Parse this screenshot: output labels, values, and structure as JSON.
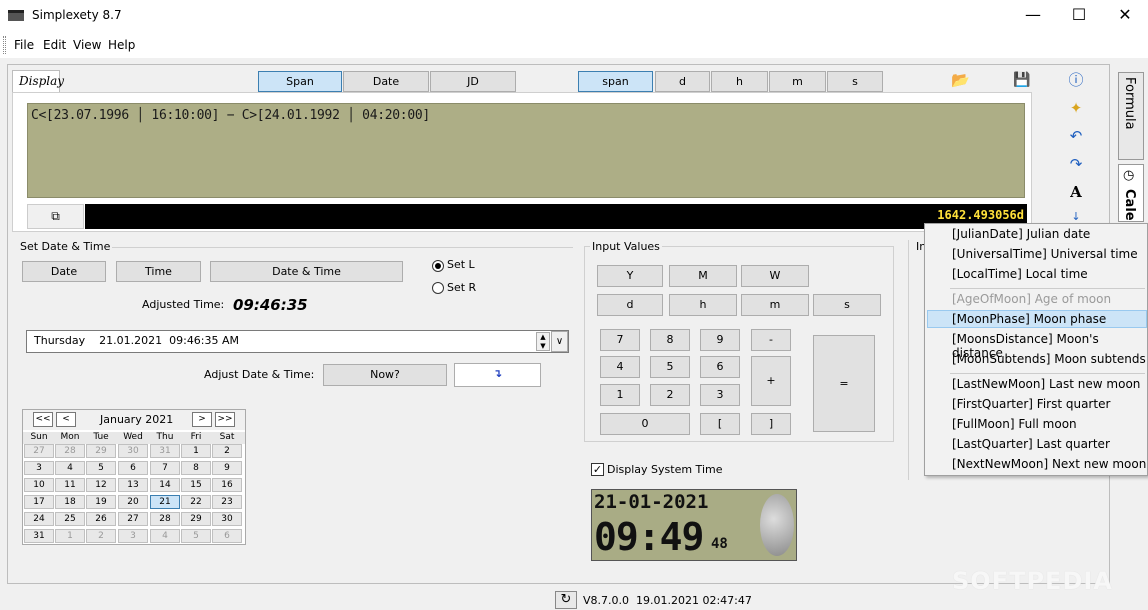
{
  "window": {
    "title": "Simplexety 8.7"
  },
  "menu": [
    "File",
    "Edit",
    "View",
    "Help"
  ],
  "display": {
    "tab_label": "Display",
    "mode_buttons": [
      "Span",
      "Date",
      "JD"
    ],
    "unit_buttons": [
      "span",
      "d",
      "h",
      "m",
      "s"
    ],
    "expression": "C<[23.07.1996 │ 16:10:00] − C>[24.01.1992 │ 04:20:00]",
    "result": "1642.493056d"
  },
  "side_tabs": [
    "Formula",
    "Cale"
  ],
  "set_date_time": {
    "group_label": "Set Date & Time",
    "buttons": [
      "Date",
      "Time",
      "Date & Time"
    ],
    "radio_l": "Set L",
    "radio_r": "Set R",
    "adjusted_label": "Adjusted Time:",
    "adjusted_value": "09:46:35",
    "combo_value": "Thursday    21.01.2021  09:46:35 AM",
    "adjust_label": "Adjust Date & Time:",
    "now_button": "Now?",
    "apply_button": "↴"
  },
  "calendar": {
    "month_label": "January  2021",
    "nav": [
      "<<",
      "<",
      ">",
      ">>"
    ],
    "dows": [
      "Sun",
      "Mon",
      "Tue",
      "Wed",
      "Thu",
      "Fri",
      "Sat"
    ],
    "weeks": [
      [
        "27",
        "28",
        "29",
        "30",
        "31",
        "1",
        "2"
      ],
      [
        "3",
        "4",
        "5",
        "6",
        "7",
        "8",
        "9"
      ],
      [
        "10",
        "11",
        "12",
        "13",
        "14",
        "15",
        "16"
      ],
      [
        "17",
        "18",
        "19",
        "20",
        "21",
        "22",
        "23"
      ],
      [
        "24",
        "25",
        "26",
        "27",
        "28",
        "29",
        "30"
      ],
      [
        "31",
        "1",
        "2",
        "3",
        "4",
        "5",
        "6"
      ]
    ],
    "selected": "21"
  },
  "input_values": {
    "group_label": "Input Values",
    "row1": [
      "Y",
      "M",
      "W"
    ],
    "row2": [
      "d",
      "h",
      "m",
      "s"
    ],
    "keys": [
      "7",
      "8",
      "9",
      "-",
      "4",
      "5",
      "6",
      "+",
      "1",
      "2",
      "3",
      "0",
      "[",
      "]",
      "="
    ]
  },
  "clock": {
    "checkbox_label": "Display System Time",
    "date": "21-01-2021",
    "time": "09:49",
    "seconds": "48"
  },
  "context_menu": {
    "items": [
      {
        "text": "[JulianDate] Julian date",
        "state": "normal"
      },
      {
        "text": "[UniversalTime] Universal time",
        "state": "normal"
      },
      {
        "text": "[LocalTime] Local time",
        "state": "normal"
      },
      {
        "text": "[AgeOfMoon] Age of moon",
        "state": "disabled"
      },
      {
        "text": "[MoonPhase] Moon phase",
        "state": "highlighted"
      },
      {
        "text": "[MoonsDistance] Moon's distance",
        "state": "normal"
      },
      {
        "text": "[MoonSubtends] Moon subtends",
        "state": "normal"
      },
      {
        "text": "[LastNewMoon] Last new moon",
        "state": "normal"
      },
      {
        "text": "[FirstQuarter] First quarter",
        "state": "normal"
      },
      {
        "text": "[FullMoon] Full moon",
        "state": "normal"
      },
      {
        "text": "[LastQuarter] Last quarter",
        "state": "normal"
      },
      {
        "text": "[NextNewMoon] Next new moon",
        "state": "normal"
      }
    ]
  },
  "status": {
    "version": "V8.7.0.0  19.01.2021 02:47:47"
  },
  "watermark": "SOFTPEDIA",
  "partial_label": "In"
}
